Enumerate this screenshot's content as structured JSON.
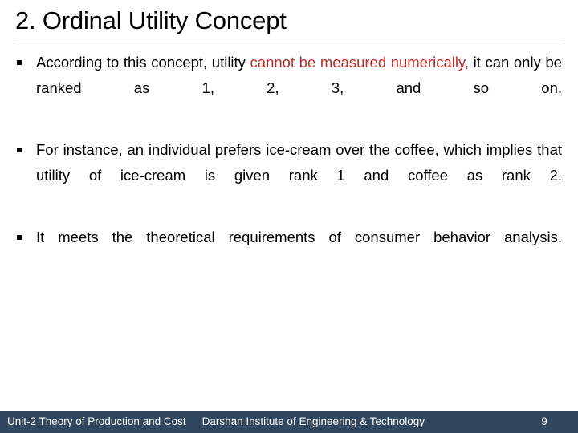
{
  "slide": {
    "title": "2. Ordinal Utility Concept",
    "accent_color": "#bd2a2a",
    "footer_color": "#31475f",
    "rule_color": "#d2d2d2",
    "bullet_glyph": "square-bullet",
    "bullets": [
      {
        "marker": "§",
        "segments": [
          {
            "text": "According to this concept, utility ",
            "style": "normal"
          },
          {
            "text": "cannot be measured numerically,",
            "style": "red"
          },
          {
            "text": " it can only be ranked as 1, 2, 3, and so on.",
            "style": "normal"
          }
        ],
        "plain": "According to this concept, utility cannot be measured numerically, it can only be ranked as 1, 2, 3, and so on."
      },
      {
        "marker": "§",
        "segments": [
          {
            "text": "For instance, an individual prefers ice-cream over the coffee, which implies that utility of ice-cream is given rank 1 and coffee as rank 2.",
            "style": "normal"
          }
        ],
        "plain": "For instance, an individual prefers ice-cream over the coffee, which implies that utility of ice-cream is given rank 1 and coffee as rank 2."
      },
      {
        "marker": "§",
        "segments": [
          {
            "text": "It meets the theoretical requirements of consumer behavior analysis.",
            "style": "normal"
          }
        ],
        "plain": "It meets the theoretical requirements of consumer behavior analysis."
      }
    ]
  },
  "footer": {
    "unit_label": "Unit-2 Theory of Production and Cost",
    "institute": "Darshan Institute of Engineering & Technology",
    "page_number": "9"
  }
}
